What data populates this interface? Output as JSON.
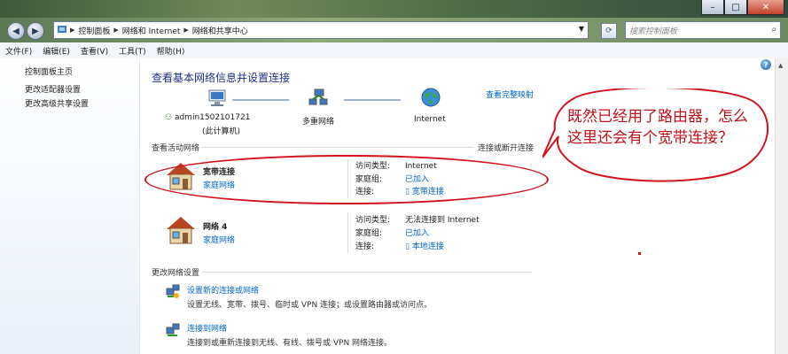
{
  "window": {
    "minimize": "–",
    "maximize": "□",
    "close": "✕"
  },
  "address": {
    "segments": [
      "控制面板",
      "网络和 Internet",
      "网络和共享中心"
    ],
    "search_placeholder": "搜索控制面板"
  },
  "menu": [
    "文件(F)",
    "编辑(E)",
    "查看(V)",
    "工具(T)",
    "帮助(H)"
  ],
  "sidebar": [
    "控制面板主页",
    "更改适配器设置",
    "更改高级共享设置"
  ],
  "main": {
    "title": "查看基本网络信息并设置连接",
    "map_link": "查看完整映射",
    "nodes": {
      "computer_name": "admin1502101721",
      "computer_sub": "(此计算机)",
      "network": "多重网络",
      "internet": "Internet"
    },
    "active_section": "查看活动网络",
    "connect_link": "连接或断开连接",
    "networks": [
      {
        "name": "宽带连接",
        "type": "家庭网络",
        "access_label": "访问类型:",
        "access_value": "Internet",
        "group_label": "家庭组:",
        "group_value": "已加入",
        "conn_label": "连接:",
        "conn_value": "宽带连接"
      },
      {
        "name": "网络  4",
        "type": "家庭网络",
        "access_label": "访问类型:",
        "access_value": "无法连接到 Internet",
        "group_label": "家庭组:",
        "group_value": "已加入",
        "conn_label": "连接:",
        "conn_value": "本地连接"
      }
    ],
    "change_section": "更改网络设置",
    "tasks": [
      {
        "title": "设置新的连接或网络",
        "desc": "设置无线、宽带、拨号、临时或 VPN 连接；或设置路由器或访问点。"
      },
      {
        "title": "连接到网络",
        "desc": "连接到或重新连接到无线、有线、拨号或 VPN 网络连接。"
      }
    ]
  },
  "annotation": {
    "text": "既然已经用了路由器，怎么这里还会有个宽带连接？",
    "color": "#d0141e"
  }
}
